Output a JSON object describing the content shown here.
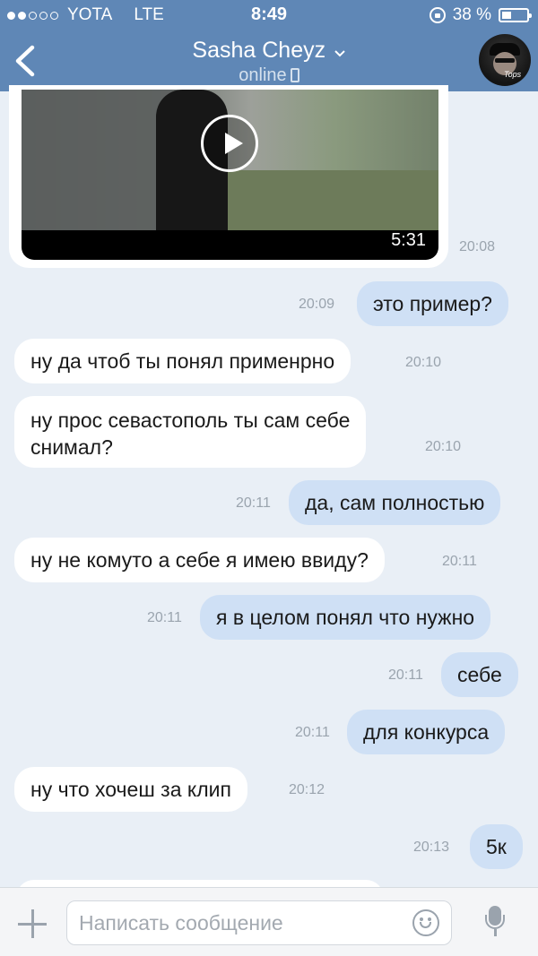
{
  "status_bar": {
    "carrier": "YOTA",
    "network": "LTE",
    "time": "8:49",
    "battery": "38 %",
    "battery_level": 0.38
  },
  "nav": {
    "contact_name": "Sasha Cheyz",
    "contact_status": "online"
  },
  "video": {
    "duration": "5:31",
    "time": "20:08"
  },
  "messages": [
    {
      "dir": "out",
      "text": "это пример?",
      "time": "20:09"
    },
    {
      "dir": "in",
      "text": "ну да чтоб ты понял применрно",
      "time": "20:10"
    },
    {
      "dir": "in",
      "text_line1": "ну прос севастополь ты сам себе",
      "text_line2": "снимал?",
      "time": "20:10"
    },
    {
      "dir": "out",
      "text": "да, сам полностью",
      "time": "20:11"
    },
    {
      "dir": "in",
      "text": "ну не комуто а себе я имею ввиду?",
      "time": "20:11"
    },
    {
      "dir": "out",
      "text": "я в целом понял что нужно",
      "time": "20:11"
    },
    {
      "dir": "out",
      "text": "себе",
      "time": "20:11"
    },
    {
      "dir": "out",
      "text": "для конкурса",
      "time": "20:11"
    },
    {
      "dir": "in",
      "text": "ну что хочеш за клип",
      "time": "20:12"
    },
    {
      "dir": "out",
      "text": "5к",
      "time": "20:13"
    }
  ],
  "input": {
    "placeholder": "Написать сообщение"
  },
  "colors": {
    "header": "#5f87b6",
    "background": "#e9eff6",
    "outgoing_bubble": "#cfe0f5",
    "incoming_bubble": "#ffffff"
  }
}
